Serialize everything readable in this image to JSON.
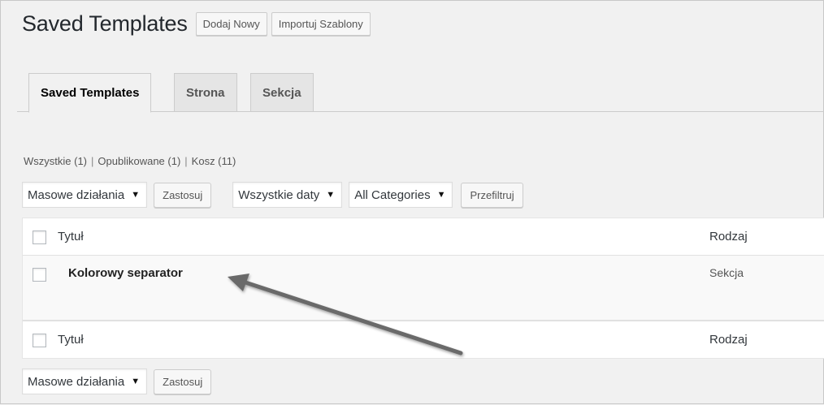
{
  "header": {
    "title": "Saved Templates",
    "add_new_label": "Dodaj Nowy",
    "import_label": "Importuj Szablony"
  },
  "tabs": [
    {
      "label": "Saved Templates",
      "active": true
    },
    {
      "label": "Strona",
      "active": false
    },
    {
      "label": "Sekcja",
      "active": false
    }
  ],
  "views": {
    "all": "Wszystkie (1)",
    "published": "Opublikowane (1)",
    "trash": "Kosz (11)",
    "separator": "|"
  },
  "tablenav_top": {
    "bulk_actions": "Masowe działania",
    "apply": "Zastosuj",
    "dates": "Wszystkie daty",
    "categories": "All Categories",
    "filter": "Przefiltruj"
  },
  "table": {
    "columns": {
      "title": "Tytuł",
      "type": "Rodzaj"
    },
    "rows": [
      {
        "title": "Kolorowy separator",
        "type": "Sekcja"
      }
    ]
  },
  "tablenav_bottom": {
    "bulk_actions": "Masowe działania",
    "apply": "Zastosuj"
  },
  "colors": {
    "background": "#f1f1f1",
    "annotation_arrow": "#6a6a6a"
  },
  "icons": {
    "dropdown": "dropdown-arrow-icon",
    "annotation": "pointer-arrow-icon"
  }
}
